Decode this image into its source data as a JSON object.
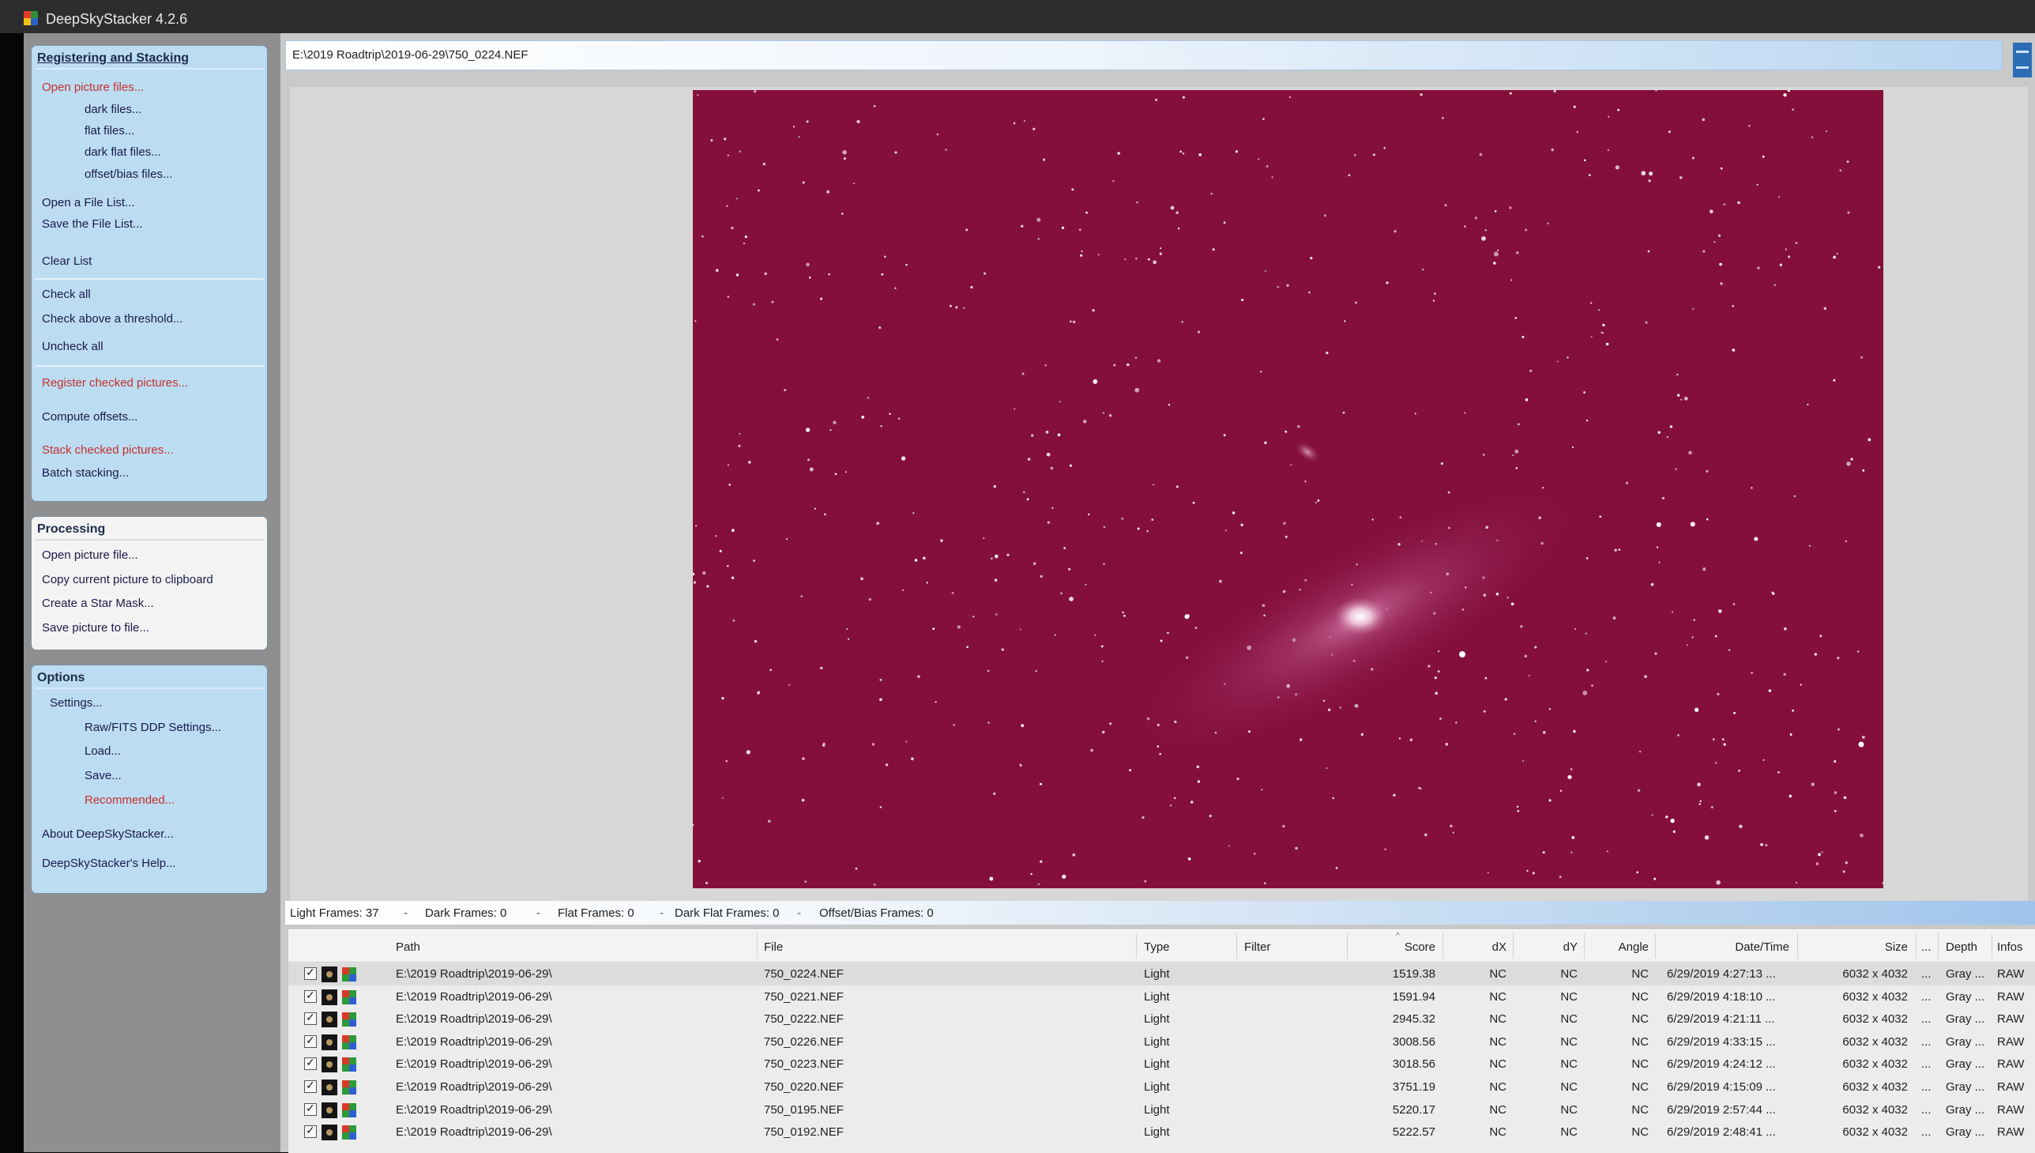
{
  "window": {
    "title": "DeepSkyStacker 4.2.6"
  },
  "path_bar": {
    "text": "E:\\2019 Roadtrip\\2019-06-29\\750_0224.NEF"
  },
  "sidebar": {
    "registering": {
      "title": "Registering and Stacking",
      "open_picture_files": "Open picture files...",
      "dark_files": "dark files...",
      "flat_files": "flat files...",
      "dark_flat_files": "dark flat files...",
      "offset_bias_files": "offset/bias files...",
      "open_file_list": "Open a File List...",
      "save_file_list": "Save the File List...",
      "clear_list": "Clear List",
      "check_all": "Check all",
      "check_above_threshold": "Check above a threshold...",
      "uncheck_all": "Uncheck all",
      "register_checked": "Register checked pictures...",
      "compute_offsets": "Compute offsets...",
      "stack_checked": "Stack checked pictures...",
      "batch_stacking": "Batch stacking..."
    },
    "processing": {
      "title": "Processing",
      "open_picture_file": "Open picture file...",
      "copy_to_clipboard": "Copy current picture to clipboard",
      "create_star_mask": "Create a Star Mask...",
      "save_picture": "Save picture to file..."
    },
    "options": {
      "title": "Options",
      "settings": "Settings...",
      "raw_fits_settings": "Raw/FITS DDP Settings...",
      "load": "Load...",
      "save": "Save...",
      "recommended": "Recommended...",
      "about": "About DeepSkyStacker...",
      "help": "DeepSkyStacker's Help..."
    }
  },
  "frame_tabs": {
    "light": "Light Frames: 37",
    "dark": "Dark Frames: 0",
    "flat": "Flat Frames: 0",
    "dark_flat": "Dark Flat Frames: 0",
    "offset_bias": "Offset/Bias Frames: 0",
    "separator": "-"
  },
  "file_list": {
    "columns": {
      "path": "Path",
      "file": "File",
      "type": "Type",
      "filter": "Filter",
      "score": "Score",
      "dx": "dX",
      "dy": "dY",
      "angle": "Angle",
      "datetime": "Date/Time",
      "size": "Size",
      "cfa": "...",
      "depth": "Depth",
      "info": "Infos"
    },
    "rows": [
      {
        "path": "E:\\2019 Roadtrip\\2019-06-29\\",
        "file": "750_0224.NEF",
        "type": "Light",
        "filter": "",
        "score": "1519.38",
        "dx": "NC",
        "dy": "NC",
        "angle": "NC",
        "datetime": "6/29/2019 4:27:13 ...",
        "size": "6032 x 4032",
        "cfa": "...",
        "depth": "Gray ...",
        "info": "RAW"
      },
      {
        "path": "E:\\2019 Roadtrip\\2019-06-29\\",
        "file": "750_0221.NEF",
        "type": "Light",
        "filter": "",
        "score": "1591.94",
        "dx": "NC",
        "dy": "NC",
        "angle": "NC",
        "datetime": "6/29/2019 4:18:10 ...",
        "size": "6032 x 4032",
        "cfa": "...",
        "depth": "Gray ...",
        "info": "RAW"
      },
      {
        "path": "E:\\2019 Roadtrip\\2019-06-29\\",
        "file": "750_0222.NEF",
        "type": "Light",
        "filter": "",
        "score": "2945.32",
        "dx": "NC",
        "dy": "NC",
        "angle": "NC",
        "datetime": "6/29/2019 4:21:11 ...",
        "size": "6032 x 4032",
        "cfa": "...",
        "depth": "Gray ...",
        "info": "RAW"
      },
      {
        "path": "E:\\2019 Roadtrip\\2019-06-29\\",
        "file": "750_0226.NEF",
        "type": "Light",
        "filter": "",
        "score": "3008.56",
        "dx": "NC",
        "dy": "NC",
        "angle": "NC",
        "datetime": "6/29/2019 4:33:15 ...",
        "size": "6032 x 4032",
        "cfa": "...",
        "depth": "Gray ...",
        "info": "RAW"
      },
      {
        "path": "E:\\2019 Roadtrip\\2019-06-29\\",
        "file": "750_0223.NEF",
        "type": "Light",
        "filter": "",
        "score": "3018.56",
        "dx": "NC",
        "dy": "NC",
        "angle": "NC",
        "datetime": "6/29/2019 4:24:12 ...",
        "size": "6032 x 4032",
        "cfa": "...",
        "depth": "Gray ...",
        "info": "RAW"
      },
      {
        "path": "E:\\2019 Roadtrip\\2019-06-29\\",
        "file": "750_0220.NEF",
        "type": "Light",
        "filter": "",
        "score": "3751.19",
        "dx": "NC",
        "dy": "NC",
        "angle": "NC",
        "datetime": "6/29/2019 4:15:09 ...",
        "size": "6032 x 4032",
        "cfa": "...",
        "depth": "Gray ...",
        "info": "RAW"
      },
      {
        "path": "E:\\2019 Roadtrip\\2019-06-29\\",
        "file": "750_0195.NEF",
        "type": "Light",
        "filter": "",
        "score": "5220.17",
        "dx": "NC",
        "dy": "NC",
        "angle": "NC",
        "datetime": "6/29/2019 2:57:44 ...",
        "size": "6032 x 4032",
        "cfa": "...",
        "depth": "Gray ...",
        "info": "RAW"
      },
      {
        "path": "E:\\2019 Roadtrip\\2019-06-29\\",
        "file": "750_0192.NEF",
        "type": "Light",
        "filter": "",
        "score": "5222.57",
        "dx": "NC",
        "dy": "NC",
        "angle": "NC",
        "datetime": "6/29/2019 2:48:41 ...",
        "size": "6032 x 4032",
        "cfa": "...",
        "depth": "Gray ...",
        "info": "RAW"
      }
    ]
  },
  "colors": {
    "image_background": "#840f3a",
    "panel_blue": "#bcdcf2",
    "link_red": "#c4302b",
    "link_navy": "#1a1a4a"
  }
}
